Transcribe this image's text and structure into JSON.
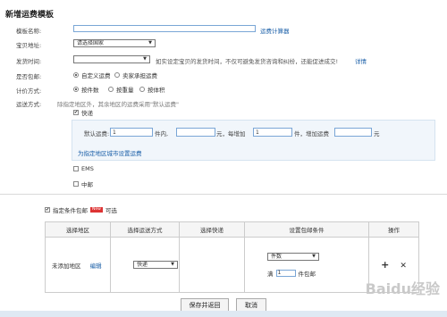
{
  "page": {
    "title": "新增运费模板"
  },
  "form": {
    "template_name_label": "模板名称:",
    "template_name_value": "",
    "calc_link": "运费计算器",
    "location_label": "宝贝地址:",
    "location_value": "请选择国家",
    "ship_time_label": "发货时间:",
    "ship_time_value": "",
    "ship_time_note": "如实设定宝贝的发货时间，不仅可避免发货咨询和纠纷，还能促进成交!",
    "ship_time_link": "详情",
    "free_label": "是否包邮:",
    "free_options": [
      "自定义运费",
      "卖家承担运费"
    ],
    "pricing_label": "计价方式:",
    "pricing_options": [
      "按件数",
      "按重量",
      "按体积"
    ],
    "method_label": "运送方式:",
    "method_note": "除指定地区外，其余地区的运费采用\"默认运费\"",
    "express_label": "快递",
    "default_fee": {
      "prefix": "默认运费:",
      "first_value": "1",
      "unit1": "件内,",
      "fee_value": "",
      "unit2": "元，每增加",
      "add_value": "1",
      "unit3": "件，增加运费",
      "add_fee_value": "",
      "unit4": "元"
    },
    "region_link": "为指定地区城市设置运费",
    "ems_label": "EMS",
    "post_label": "中邮"
  },
  "conditions": {
    "label": "指定条件包邮",
    "badge": "New",
    "suffix": "可选",
    "headers": [
      "选择地区",
      "选择运送方式",
      "选择快递",
      "设置包邮条件",
      "操作"
    ],
    "row": {
      "region": "未添加地区",
      "edit": "编辑",
      "method": "快递",
      "condition_type": "件数",
      "full_prefix": "满",
      "full_value": "1",
      "full_suffix": "件包邮",
      "add_symbol": "+",
      "remove_symbol": "✕"
    }
  },
  "buttons": {
    "save": "保存并返回",
    "cancel": "取消"
  },
  "watermark": "Baidu经验"
}
